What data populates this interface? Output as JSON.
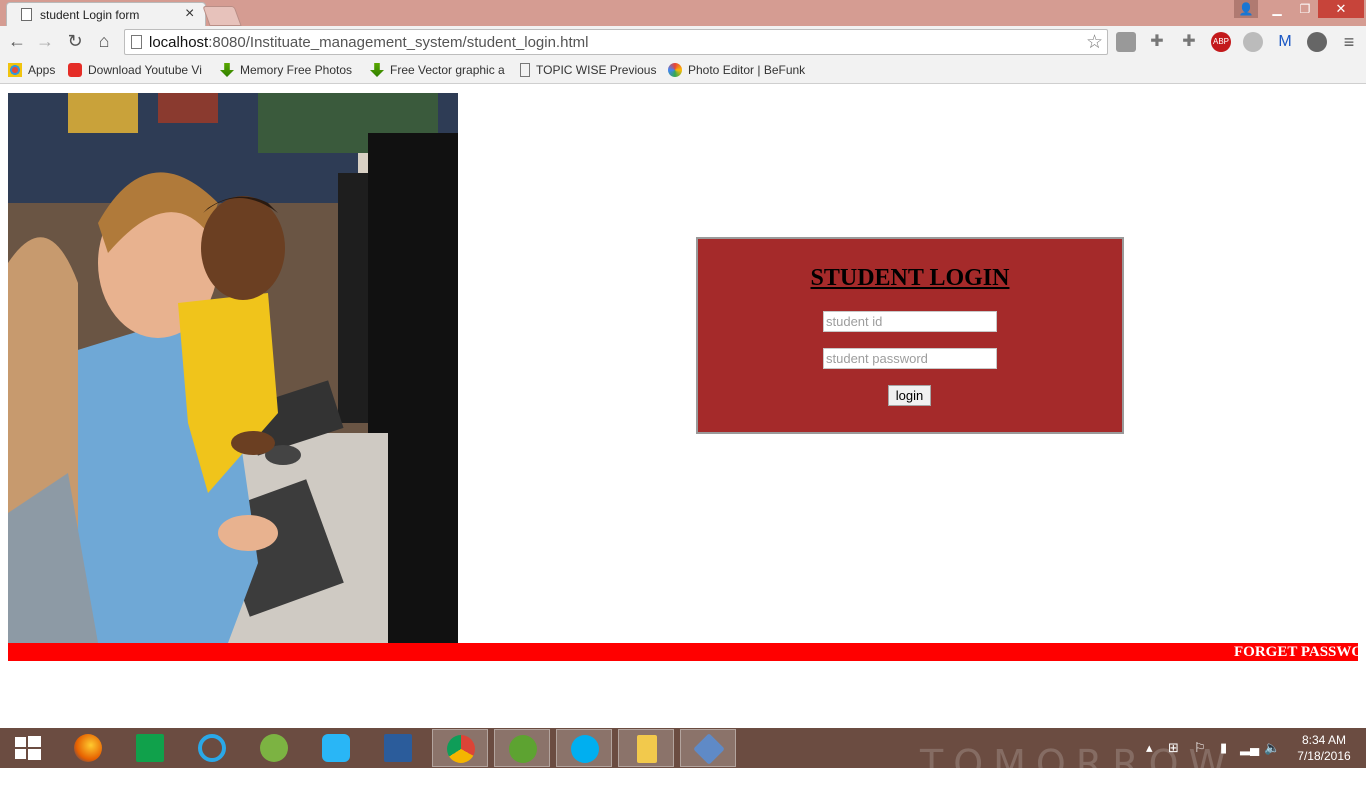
{
  "browser": {
    "tab_title": "student Login form",
    "tab_close": "×",
    "url_host": "localhost",
    "url_rest": ":8080/Instituate_management_system/student_login.html",
    "bookmarks": [
      "Apps",
      "Download Youtube Vi",
      "Memory Free Photos",
      "Free Vector graphic a",
      "TOPIC WISE Previous",
      "Photo Editor | BeFunk"
    ]
  },
  "login": {
    "title": "STUDENT LOGIN",
    "id_placeholder": "student id",
    "password_placeholder": "student password",
    "button_label": "login"
  },
  "footer_marquee": "FORGET PASSWO",
  "taskbar": {
    "time": "8:34 AM",
    "date": "7/18/2016",
    "wallpaper_text": "TOMORROW"
  }
}
